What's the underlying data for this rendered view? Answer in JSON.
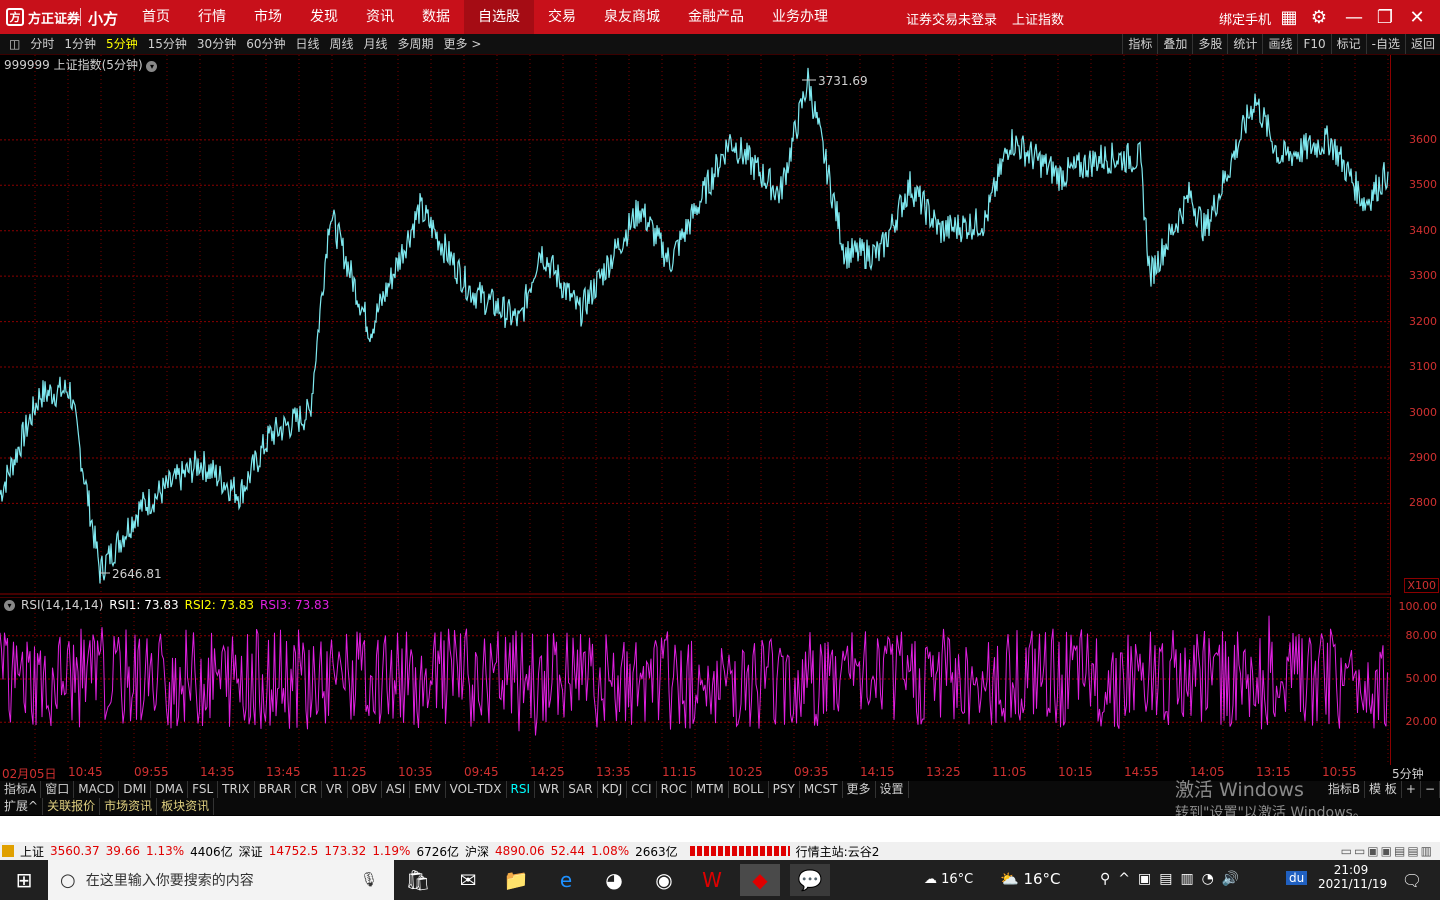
{
  "topbar": {
    "brand": "方正证券",
    "product": "小方",
    "nav": [
      "首页",
      "行情",
      "市场",
      "发现",
      "资讯",
      "数据",
      "自选股",
      "交易",
      "泉友商城",
      "金融产品",
      "业务办理"
    ],
    "nav_active": "自选股",
    "login": "证券交易未登录",
    "index_name": "上证指数",
    "bind_phone": "绑定手机"
  },
  "periods": {
    "items": [
      "分时",
      "1分钟",
      "5分钟",
      "15分钟",
      "30分钟",
      "60分钟",
      "日线",
      "周线",
      "月线",
      "多周期",
      "更多 >"
    ],
    "active": "5分钟",
    "right": [
      "指标",
      "叠加",
      "多股",
      "统计",
      "画线",
      "F10",
      "标记",
      "-自选",
      "返回"
    ]
  },
  "chart": {
    "title": "999999 上证指数(5分钟)",
    "high_label": "3731.69",
    "low_label": "2646.81",
    "scale_label": "X100",
    "y_ticks": [
      "3600",
      "3500",
      "3400",
      "3300",
      "3200",
      "3100",
      "3000",
      "2900",
      "2800"
    ]
  },
  "rsi": {
    "name": "RSI(14,14,14)",
    "rsi1": "RSI1: 73.83",
    "rsi2": "RSI2: 73.83",
    "rsi3": "RSI3: 73.83",
    "y_ticks": [
      "100.00",
      "80.00",
      "50.00",
      "20.00"
    ]
  },
  "time_axis": {
    "labels": [
      "02月05日",
      "10:45",
      "09:55",
      "14:35",
      "13:45",
      "11:25",
      "10:35",
      "09:45",
      "14:25",
      "13:35",
      "11:15",
      "10:25",
      "09:35",
      "14:15",
      "13:25",
      "11:05",
      "10:15",
      "14:55",
      "14:05",
      "13:15",
      "10:55"
    ],
    "period": "5分钟"
  },
  "indicators": {
    "items": [
      "指标A",
      "窗口",
      "MACD",
      "DMI",
      "DMA",
      "FSL",
      "TRIX",
      "BRAR",
      "CR",
      "VR",
      "OBV",
      "ASI",
      "EMV",
      "VOL-TDX",
      "RSI",
      "WR",
      "SAR",
      "KDJ",
      "CCI",
      "ROC",
      "MTM",
      "BOLL",
      "PSY",
      "MCST",
      "更多",
      "设置"
    ],
    "active": "RSI",
    "right": [
      "指标B",
      "模 板",
      "+",
      "−"
    ]
  },
  "ext": {
    "items": [
      "扩展^",
      "关联报价",
      "市场资讯",
      "板块资讯"
    ]
  },
  "status": {
    "sh_name": "上证",
    "sh_price": "3560.37",
    "sh_chg": "39.66",
    "sh_pct": "1.13%",
    "sh_vol": "4406亿",
    "sz_name": "深证",
    "sz_price": "14752.5",
    "sz_chg": "173.32",
    "sz_pct": "1.19%",
    "sz_vol": "6726亿",
    "hs_name": "沪深",
    "hs_price": "4890.06",
    "hs_chg": "52.44",
    "hs_pct": "1.08%",
    "hs_vol": "2663亿",
    "server": "行情主站:云谷2"
  },
  "watermark": {
    "line1": "激活 Windows",
    "line2": "转到\"设置\"以激活 Windows。"
  },
  "taskbar": {
    "search_placeholder": "在这里输入你要搜索的内容",
    "weather1": "16°C",
    "weather2": "16°C",
    "time": "21:09",
    "date": "2021/11/19",
    "ime": "du"
  },
  "colors": {
    "top": "#c8101a",
    "price_line": "#7fe9f0",
    "rsi_line": "#e020e0",
    "grid": "#7a0000"
  }
}
